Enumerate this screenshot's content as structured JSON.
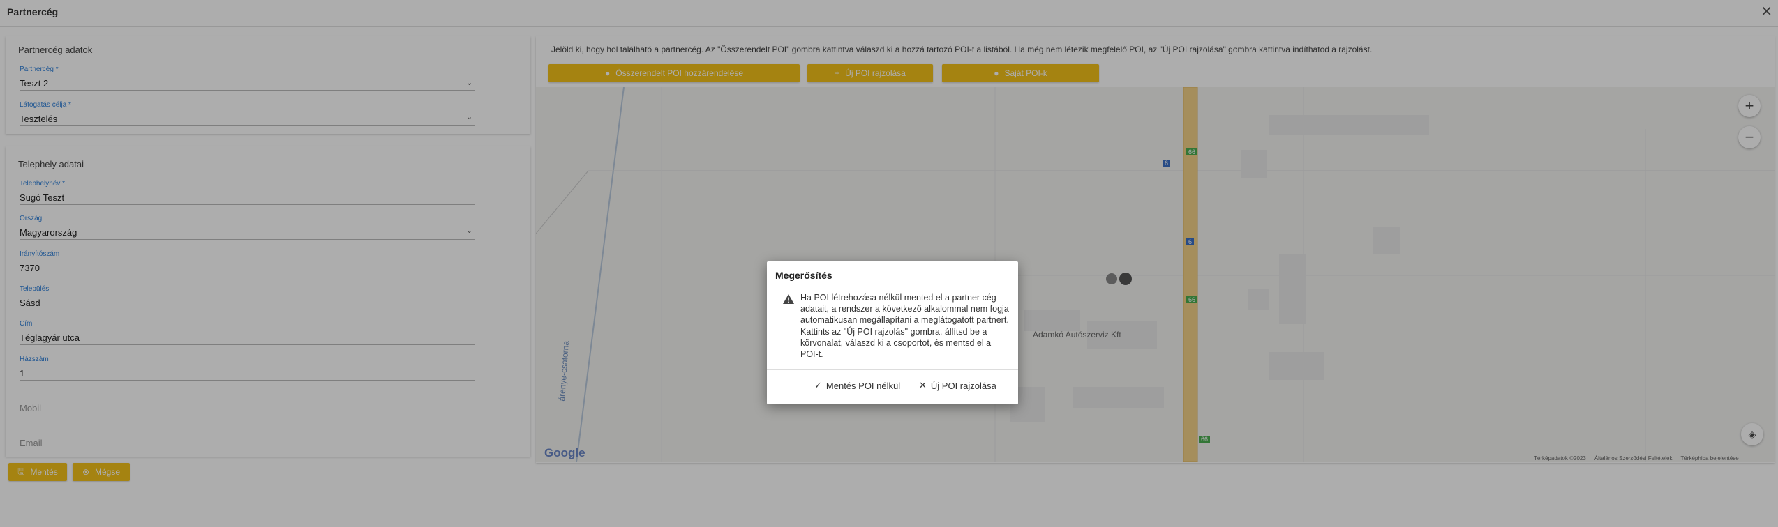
{
  "window": {
    "title": "Partnercég",
    "close_icon": "close-icon"
  },
  "partner_section": {
    "title": "Partnercég adatok",
    "partner": {
      "label": "Partnercég *",
      "value": "Teszt 2"
    },
    "visit_type": {
      "label": "Látogatás célja *",
      "value": "Tesztelés"
    }
  },
  "site_section": {
    "title": "Telephely adatai",
    "fields": [
      {
        "label": "Telephelynév *",
        "value": "Sugó Teszt",
        "select": false
      },
      {
        "label": "Ország",
        "value": "Magyarország",
        "select": true
      },
      {
        "label": "Irányítószám",
        "value": "7370",
        "select": false
      },
      {
        "label": "Település",
        "value": "Sásd",
        "select": false
      },
      {
        "label": "Cím",
        "value": "Téglagyár utca",
        "select": false
      },
      {
        "label": "Házszám",
        "value": "1",
        "select": false
      },
      {
        "label": "",
        "value": "Mobil",
        "select": false,
        "placeholder": true
      },
      {
        "label": "",
        "value": "Email",
        "select": false,
        "placeholder": true
      }
    ]
  },
  "footer_buttons": {
    "save": "Mentés",
    "cancel": "Mégse"
  },
  "map_panel": {
    "instructions": "Jelöld ki, hogy hol található a partnercég. Az \"Összerendelt POI\" gombra kattintva válaszd ki a hozzá tartozó POI-t a listából. Ha még nem létezik megfelelő POI, az \"Új POI rajzolása\" gombra kattintva indíthatod a rajzolást.",
    "buttons": {
      "assigned_poi": "Összerendelt POI hozzárendelése",
      "new_poi": "Új POI rajzolása",
      "select_poi": "Saját POI-k"
    },
    "map": {
      "business_label": "Adamkó Autószerviz Kft",
      "canal_label": "árenye-csatorna",
      "route_badges": [
        "66",
        "6",
        "6",
        "66",
        "66"
      ],
      "google_logo": "Google",
      "attribution": [
        "Térképadatok ©2023",
        "Általános Szerződési Feltételek",
        "Térképhiba bejelentése"
      ],
      "zoom_in": "+",
      "zoom_out": "−"
    }
  },
  "dialog": {
    "title": "Megerősítés",
    "message": "Ha POI létrehozása nélkül mented el a partner cég adatait, a rendszer a következő alkalommal nem fogja automatikusan megállapítani a meglátogatott partnert. Kattints az \"Új POI rajzolás\" gombra, állítsd be a körvonalat, válaszd ki a csoportot, és mentsd el a POI-t.",
    "save_without_poi": "Mentés POI nélkül",
    "draw_new_poi": "Új POI rajzolása",
    "colors": {
      "overlay": "#000000",
      "accent": "#f4c21a",
      "label": "#2f7fd8"
    }
  }
}
